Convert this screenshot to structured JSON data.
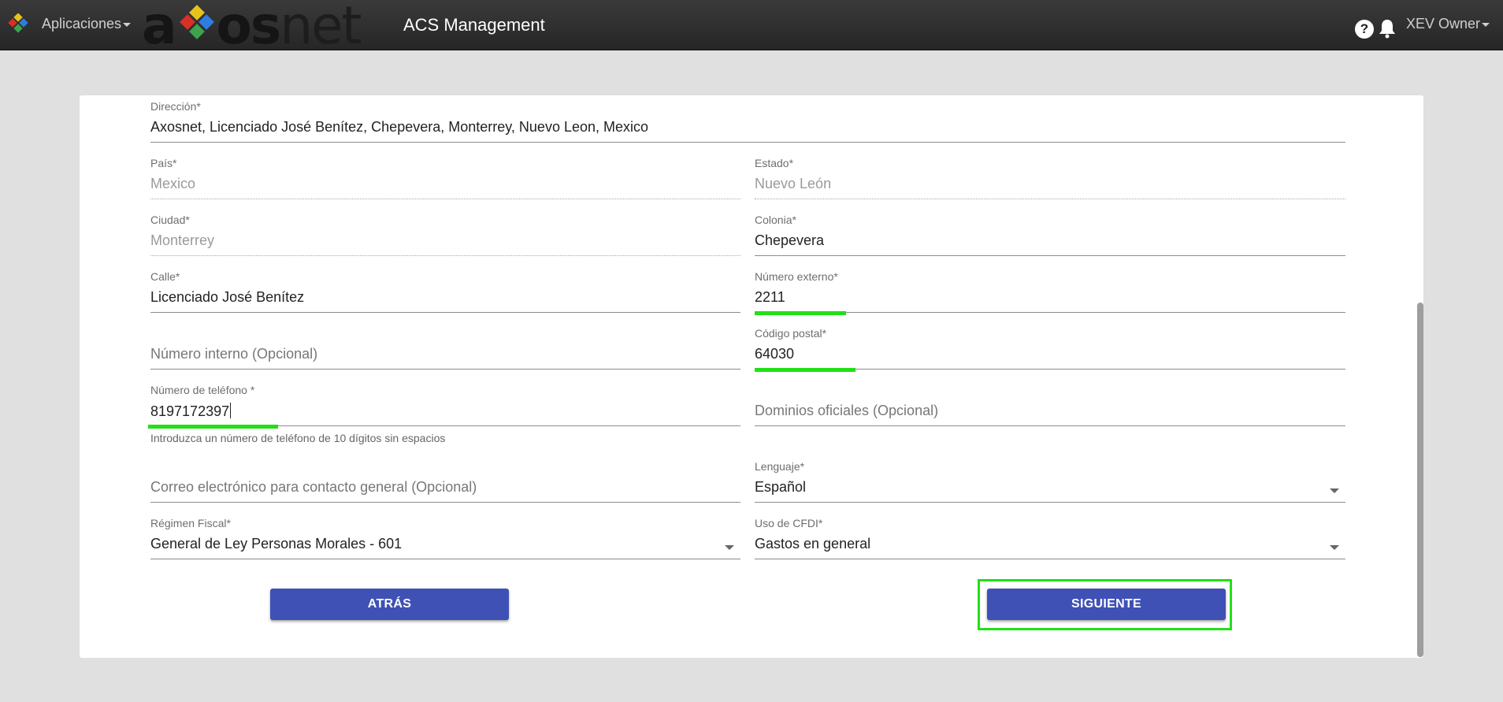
{
  "header": {
    "apps_label": "Aplicaciones",
    "brand_prefix": "a",
    "brand_mid": "os",
    "brand_suffix": "net",
    "app_title": "ACS Management",
    "help_glyph": "?",
    "user_label": "XEV Owner"
  },
  "form": {
    "direccion": {
      "label": "Dirección*",
      "value": "Axosnet, Licenciado José Benítez, Chepevera, Monterrey, Nuevo Leon, Mexico"
    },
    "pais": {
      "label": "País*",
      "value": "Mexico"
    },
    "estado": {
      "label": "Estado*",
      "value": "Nuevo León"
    },
    "ciudad": {
      "label": "Ciudad*",
      "value": "Monterrey"
    },
    "colonia": {
      "label": "Colonia*",
      "value": "Chepevera"
    },
    "calle": {
      "label": "Calle*",
      "value": "Licenciado José Benítez"
    },
    "numero_externo": {
      "label": "Número externo*",
      "value": "2211"
    },
    "numero_interno": {
      "placeholder": "Número interno (Opcional)"
    },
    "codigo_postal": {
      "label": "Código postal*",
      "value": "64030"
    },
    "telefono": {
      "label": "Número de teléfono *",
      "value": "8197172397",
      "hint": "Introduzca un número de teléfono de 10 dígitos sin espacios"
    },
    "dominios": {
      "placeholder": "Dominios oficiales (Opcional)"
    },
    "correo": {
      "placeholder": "Correo electrónico para contacto general (Opcional)"
    },
    "lenguaje": {
      "label": "Lenguaje*",
      "value": "Español"
    },
    "regimen": {
      "label": "Régimen Fiscal*",
      "value": "General de Ley Personas Morales - 601"
    },
    "cfdi": {
      "label": "Uso de CFDI*",
      "value": "Gastos en general"
    }
  },
  "buttons": {
    "back_label": "ATRÁS",
    "next_label": "SIGUIENTE"
  },
  "colors": {
    "primary": "#3f51b5",
    "annotation": "#22e017",
    "topbar": "#2e2e2e"
  }
}
